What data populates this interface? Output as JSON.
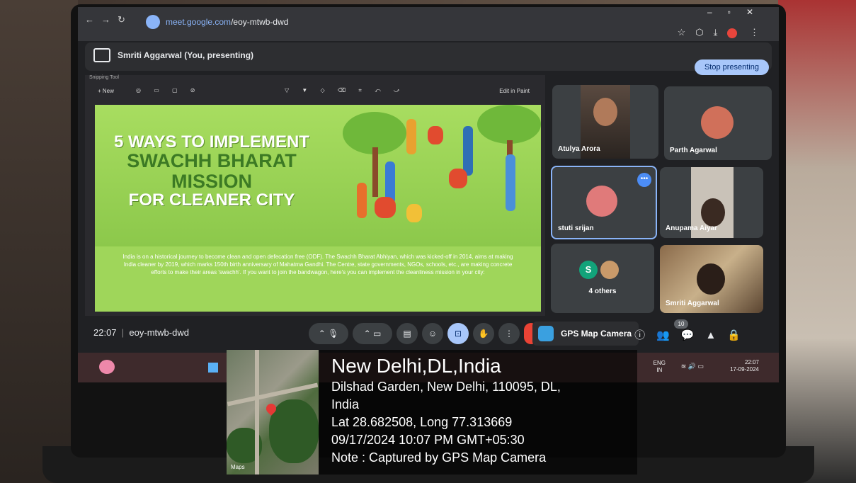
{
  "browser": {
    "url_domain": "meet.google.com",
    "url_path": "/eoy-mtwb-dwd"
  },
  "presenting": {
    "label": "Smriti Aggarwal (You, presenting)",
    "stop_button": "Stop presenting"
  },
  "snipping_tool": {
    "title": "Snipping Tool",
    "new_label": "+ New",
    "edit_in_paint": "Edit in Paint"
  },
  "slide": {
    "title_line1": "5 WAYS TO IMPLEMENT",
    "title_line2": "SWACHH BHARAT MISSION",
    "title_line3": "FOR CLEANER CITY",
    "description": "India is on a historical journey to become clean and open defecation free (ODF). The Swachh Bharat Abhiyan, which was kicked-off in 2014, aims at making India cleaner by 2019, which marks 150th birth anniversary of Mahatma Gandhi. The Centre, state governments, NGOs, schools, etc., are making concrete efforts to make their areas 'swachh'. If you want to join the bandwagon, here's you can implement the cleanliness mission in your city:"
  },
  "participants": [
    {
      "name": "Atulya Arora"
    },
    {
      "name": "Parth Agarwal"
    },
    {
      "name": "stuti srijan"
    },
    {
      "name": "Anupama Aiyar"
    },
    {
      "name": "4 others",
      "initial": "S"
    },
    {
      "name": "Smriti Aggarwal"
    }
  ],
  "meeting": {
    "time": "22:07",
    "code": "eoy-mtwb-dwd",
    "people_count": "10"
  },
  "gps_camera_label": "GPS Map Camera",
  "taskbar": {
    "lang": "ENG",
    "region": "IN",
    "time": "22:07",
    "date": "17-09-2024"
  },
  "gps": {
    "city": "New Delhi,DL,India",
    "address_line1": "Dilshad Garden, New Delhi, 110095, DL,",
    "address_line2": "India",
    "coords": "Lat 28.682508, Long 77.313669",
    "datetime": "09/17/2024 10:07 PM GMT+05:30",
    "note": "Note : Captured by GPS Map Camera",
    "maps_label": "Maps"
  },
  "colors": {
    "stop_button": "#a8c7fa",
    "slide_bg": "#9fd65a",
    "accent_blue": "#4c8df6"
  }
}
